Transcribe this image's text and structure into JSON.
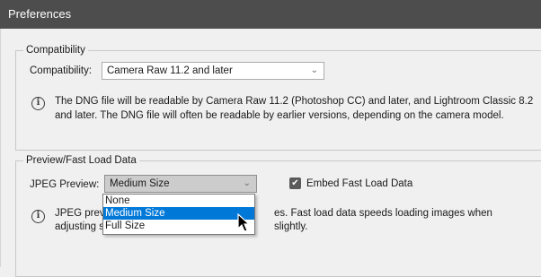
{
  "window": {
    "title": "Preferences"
  },
  "compatibility_group": {
    "legend": "Compatibility",
    "label": "Compatibility:",
    "selected": "Camera Raw 11.2 and later",
    "info_line1": "The DNG file will be readable by Camera Raw 11.2 (Photoshop CC) and later, and Lightroom Classic 8.2",
    "info_line2": "and later. The DNG file will often be readable by earlier versions, depending on the camera model."
  },
  "preview_group": {
    "legend": "Preview/Fast Load Data",
    "jpeg_label": "JPEG Preview:",
    "jpeg_selected": "Medium Size",
    "embed_label": "Embed Fast Load Data",
    "embed_checked": true,
    "info_line1_left": "JPEG previ",
    "info_line1_right": "es.  Fast load data speeds loading images when",
    "info_line2_left": "adjusting s",
    "info_line2_right": "slightly.",
    "options": [
      "None",
      "Medium Size",
      "Full Size"
    ],
    "highlighted_option": "Medium Size"
  },
  "icons": {
    "info": "info-icon",
    "chevron": "chevron-down-icon",
    "check": "checkmark-icon",
    "cursor": "mouse-pointer-icon"
  },
  "colors": {
    "titlebar": "#4d4d4d",
    "selection": "#0078d7",
    "checkbox": "#5a5a5a"
  }
}
